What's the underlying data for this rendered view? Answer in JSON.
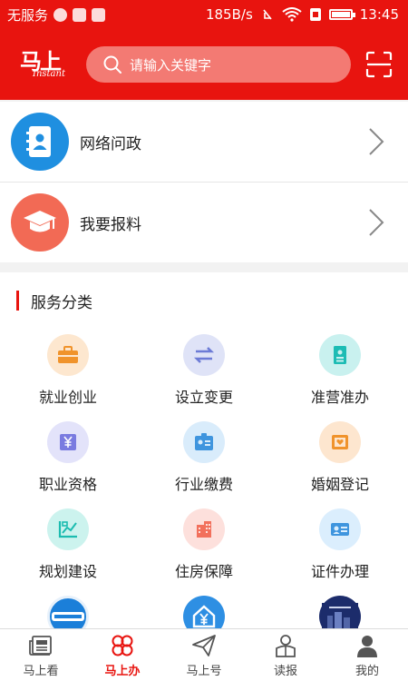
{
  "status_bar": {
    "carrier": "无服务",
    "speed": "185B/s",
    "time": "13:45",
    "battery_level": 0.9
  },
  "header": {
    "logo_cn": "马上",
    "logo_en": "Instant",
    "search_placeholder": "请输入关键字"
  },
  "entries": [
    {
      "label": "网络问政",
      "icon": "address-book-icon",
      "color": "#1f8fe0"
    },
    {
      "label": "我要报料",
      "icon": "graduation-cap-icon",
      "color": "#f26a55"
    }
  ],
  "services": {
    "title": "服务分类",
    "items": [
      {
        "label": "就业创业",
        "icon": "briefcase-icon",
        "bg": "#fde7cf",
        "fg": "#f0932b"
      },
      {
        "label": "设立变更",
        "icon": "swap-arrows-icon",
        "bg": "#dfe3f7",
        "fg": "#6c7bd6"
      },
      {
        "label": "准营准办",
        "icon": "permit-doc-icon",
        "bg": "#c9f1ef",
        "fg": "#1cbcb4"
      },
      {
        "label": "职业资格",
        "icon": "yen-card-icon",
        "bg": "#e3e3fa",
        "fg": "#7a7be0"
      },
      {
        "label": "行业缴费",
        "icon": "id-badge-icon",
        "bg": "#d9ecfb",
        "fg": "#3f95de"
      },
      {
        "label": "婚姻登记",
        "icon": "heart-certificate-icon",
        "bg": "#fde6cf",
        "fg": "#f0932b"
      },
      {
        "label": "规划建设",
        "icon": "chart-ruler-icon",
        "bg": "#ccf3ee",
        "fg": "#1cbcb0"
      },
      {
        "label": "住房保障",
        "icon": "building-icon",
        "bg": "#fde0dc",
        "fg": "#f2705c"
      },
      {
        "label": "证件办理",
        "icon": "id-card-icon",
        "bg": "#dbeefd",
        "fg": "#3f95de"
      }
    ]
  },
  "bottom_nav": [
    {
      "label": "马上看",
      "icon": "newspaper-icon",
      "active": false
    },
    {
      "label": "马上办",
      "icon": "clover-icon",
      "active": true
    },
    {
      "label": "马上号",
      "icon": "paper-plane-icon",
      "active": false
    },
    {
      "label": "读报",
      "icon": "reader-icon",
      "active": false
    },
    {
      "label": "我的",
      "icon": "user-icon",
      "active": false
    }
  ],
  "colors": {
    "brand_red": "#e8140f"
  }
}
